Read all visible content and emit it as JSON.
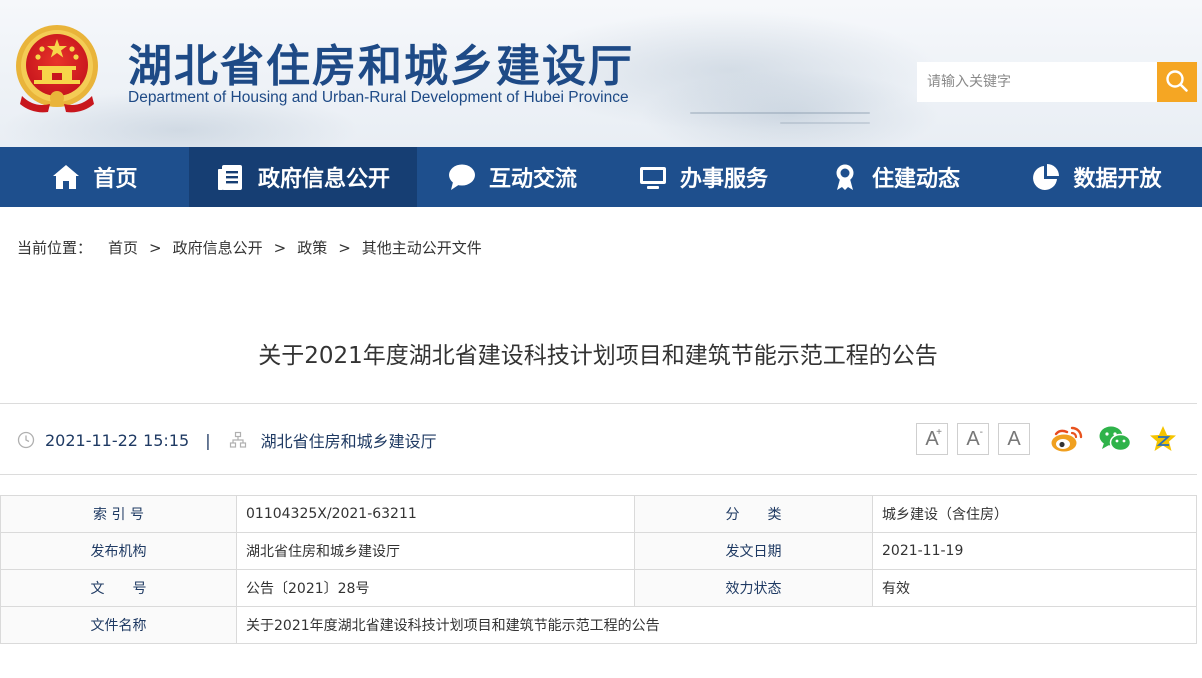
{
  "header": {
    "title": "湖北省住房和城乡建设厅",
    "subtitle": "Department of Housing and Urban-Rural Development of Hubei Province",
    "search_placeholder": "请输入关键字",
    "emblem_icon": "national-emblem",
    "search_icon": "search-icon"
  },
  "colors": {
    "primary": "#1e4f8d",
    "nav_active": "#163e73",
    "title_blue": "#1e4a86",
    "accent_orange": "#f5a623"
  },
  "nav": {
    "items": [
      {
        "label": "首页",
        "icon": "home-icon"
      },
      {
        "label": "政府信息公开",
        "icon": "document-list-icon",
        "active": true
      },
      {
        "label": "互动交流",
        "icon": "chat-bubble-icon"
      },
      {
        "label": "办事服务",
        "icon": "monitor-icon"
      },
      {
        "label": "住建动态",
        "icon": "award-ribbon-icon"
      },
      {
        "label": "数据开放",
        "icon": "pie-chart-icon"
      }
    ]
  },
  "breadcrumb": {
    "label": "当前位置：",
    "items": [
      "首页",
      "政府信息公开",
      "政策",
      "其他主动公开文件"
    ],
    "separator": ">"
  },
  "article": {
    "title": "关于2021年度湖北省建设科技计划项目和建筑节能示范工程的公告",
    "datetime": "2021-11-22 15:15",
    "separator": "|",
    "source": "湖北省住房和城乡建设厅"
  },
  "font_size_buttons": [
    {
      "label": "A",
      "sup": "+",
      "icon": "font-increase-icon"
    },
    {
      "label": "A",
      "sup": "-",
      "icon": "font-decrease-icon"
    },
    {
      "label": "A",
      "sup": "",
      "icon": "font-reset-icon"
    }
  ],
  "share_icons": [
    "weibo-icon",
    "wechat-icon",
    "qzone-icon"
  ],
  "info_table": {
    "rows": [
      {
        "label1": "索 引 号",
        "value1": "01104325X/2021-63211",
        "label2": "分　　类",
        "value2": "城乡建设（含住房）"
      },
      {
        "label1": "发布机构",
        "value1": "湖北省住房和城乡建设厅",
        "label2": "发文日期",
        "value2": "2021-11-19"
      },
      {
        "label1": "文　　号",
        "value1": "公告〔2021〕28号",
        "label2": "效力状态",
        "value2": "有效"
      }
    ],
    "name_row": {
      "label": "文件名称",
      "value": "关于2021年度湖北省建设科技计划项目和建筑节能示范工程的公告"
    }
  }
}
